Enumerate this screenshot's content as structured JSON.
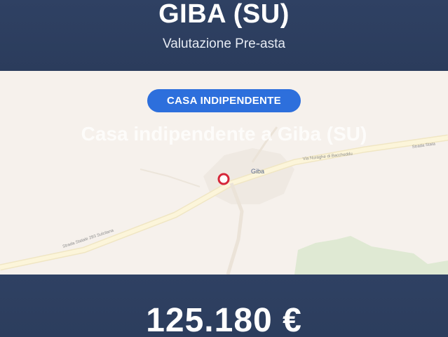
{
  "header": {
    "city": "GIBA (SU)",
    "subtitle": "Valutazione Pre-asta"
  },
  "badge": {
    "label": "CASA INDIPENDENTE"
  },
  "map": {
    "title": "Casa indipendente a Giba (SU)",
    "town_label": "Giba",
    "road_labels": [
      "Via Nuraghe di Baccheddu",
      "Strada Stata",
      "Strada Statale 293 Sulcitana"
    ],
    "colors": {
      "land": "#f6f1ec",
      "road": "#fbf4d9",
      "green": "#dfe9d3",
      "marker": "#d6283a"
    }
  },
  "footer": {
    "price": "125.180 €"
  },
  "colors": {
    "header_bg": "#2e3f5f",
    "badge_bg": "#2d6fdc"
  }
}
